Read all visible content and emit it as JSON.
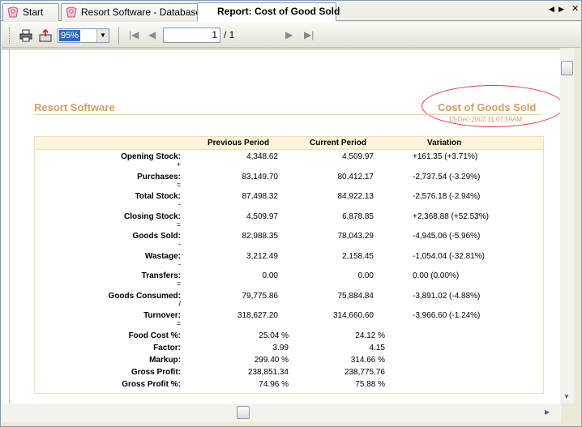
{
  "tabs": [
    {
      "label": "Start",
      "icon": "app-icon"
    },
    {
      "label": "Resort Software - Database",
      "icon": "app-icon"
    },
    {
      "label": "Report: Cost of Good Sold",
      "icon": "none"
    }
  ],
  "toolbar": {
    "zoom_value": "95%",
    "page_current": "1",
    "page_total": "/ 1"
  },
  "report": {
    "company": "Resort Software",
    "title": "Cost of Goods Sold",
    "timestamp": "13-Dec-2007  11:07:59AM",
    "columns": [
      "Previous Period",
      "Current Period",
      "Variation"
    ],
    "rows": [
      {
        "label": "Opening Stock:",
        "prev": "4,348.62",
        "curr": "4,509.97",
        "var": "+161.35  (+3.71%)",
        "op": "+"
      },
      {
        "label": "Purchases:",
        "prev": "83,149.70",
        "curr": "80,412.17",
        "var": "-2,737.54  (-3.29%)",
        "op": "="
      },
      {
        "label": "Total Stock:",
        "prev": "87,498.32",
        "curr": "84,922.13",
        "var": "-2,576.18  (-2.94%)",
        "op": "-"
      },
      {
        "label": "Closing Stock:",
        "prev": "4,509.97",
        "curr": "6,878.85",
        "var": "+2,368.88  (+52.53%)",
        "op": "="
      },
      {
        "label": "Goods Sold:",
        "prev": "82,988.35",
        "curr": "78,043.29",
        "var": "-4,945.06  (-5.96%)",
        "op": "-"
      },
      {
        "label": "Wastage:",
        "prev": "3,212.49",
        "curr": "2,158.45",
        "var": "-1,054.04  (-32.81%)",
        "op": "-"
      },
      {
        "label": "Transfers:",
        "prev": "0.00",
        "curr": "0.00",
        "var": "0.00  (0.00%)",
        "op": "="
      },
      {
        "label": "Goods Consumed:",
        "prev": "79,775.86",
        "curr": "75,884.84",
        "var": "-3,891.02  (-4.88%)",
        "op": "/"
      },
      {
        "label": "Turnover:",
        "prev": "318,627.20",
        "curr": "314,660.60",
        "var": "-3,966.60  (-1.24%)",
        "op": "="
      }
    ],
    "ratios": [
      {
        "label": "Food Cost %:",
        "prev": "25.04 %",
        "curr": "24.12 %"
      },
      {
        "label": "Factor:",
        "prev": "3.99",
        "curr": "4.15"
      },
      {
        "label": "Markup:",
        "prev": "299.40 %",
        "curr": "314.66 %"
      },
      {
        "label": "Gross Profit:",
        "prev": "238,851.34",
        "curr": "238,775.76"
      },
      {
        "label": "Gross Profit %:",
        "prev": "74.96 %",
        "curr": "75.88 %"
      }
    ]
  },
  "colors": {
    "accent": "#d0a060",
    "highlight_ellipse": "#e34040",
    "header_fill": "#fff3da"
  }
}
